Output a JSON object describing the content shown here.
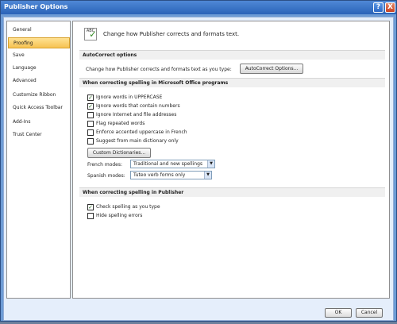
{
  "window": {
    "title": "Publisher Options",
    "help_label": "?",
    "close_label": "X"
  },
  "sidebar": {
    "items": [
      {
        "label": "General"
      },
      {
        "label": "Proofing"
      },
      {
        "label": "Save"
      },
      {
        "label": "Language"
      },
      {
        "label": "Advanced"
      },
      {
        "label": "Customize Ribbon"
      },
      {
        "label": "Quick Access Toolbar"
      },
      {
        "label": "Add-Ins"
      },
      {
        "label": "Trust Center"
      }
    ]
  },
  "header": {
    "icon_text": "ABC",
    "description": "Change how Publisher corrects and formats text."
  },
  "autocorrect": {
    "section_title": "AutoCorrect options",
    "description": "Change how Publisher corrects and formats text as you type:",
    "button_label": "AutoCorrect Options..."
  },
  "office_spelling": {
    "section_title": "When correcting spelling in Microsoft Office programs",
    "options": [
      {
        "label": "Ignore words in UPPERCASE",
        "checked": true
      },
      {
        "label": "Ignore words that contain numbers",
        "checked": true
      },
      {
        "label": "Ignore Internet and file addresses",
        "checked": false
      },
      {
        "label": "Flag repeated words",
        "checked": false
      },
      {
        "label": "Enforce accented uppercase in French",
        "checked": false
      },
      {
        "label": "Suggest from main dictionary only",
        "checked": false
      }
    ],
    "custom_dictionaries_label": "Custom Dictionaries...",
    "french_modes_label": "French modes:",
    "french_modes_value": "Traditional and new spellings",
    "spanish_modes_label": "Spanish modes:",
    "spanish_modes_value": "Tuteo verb forms only"
  },
  "publisher_spelling": {
    "section_title": "When correcting spelling in Publisher",
    "options": [
      {
        "label": "Check spelling as you type",
        "checked": true
      },
      {
        "label": "Hide spelling errors",
        "checked": false
      }
    ]
  },
  "footer": {
    "ok_label": "OK",
    "cancel_label": "Cancel"
  },
  "icons": {
    "checked_mark": "✓",
    "dropdown_arrow": "▼"
  }
}
